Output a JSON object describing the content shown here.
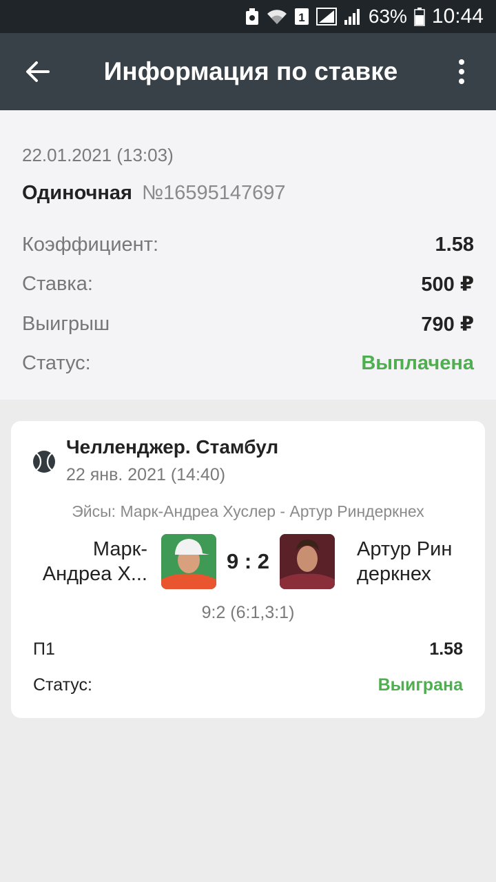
{
  "status_bar": {
    "sim_label": "1",
    "battery": "63%",
    "time": "10:44"
  },
  "app_bar": {
    "title": "Информация по ставке",
    "back_icon": "arrow-back-icon",
    "menu_icon": "more-vert-icon"
  },
  "bet": {
    "date": "22.01.2021 (13:03)",
    "type": "Одиночная",
    "number": "№16595147697",
    "rows": [
      {
        "label": "Коэффициент:",
        "value": "1.58"
      },
      {
        "label": "Ставка:",
        "value": "500 ₽"
      },
      {
        "label": "Выигрыш",
        "value": "790 ₽"
      },
      {
        "label": "Статус:",
        "value": "Выплачена"
      }
    ]
  },
  "event": {
    "sport_icon": "tennis-ball-icon",
    "league": "Челленджер. Стамбул",
    "date": "22 янв. 2021 (14:40)",
    "market": "Эйсы: Марк-Андреа Хуслер - Артур Риндеркнех",
    "team1_line1": "Марк-",
    "team1_line2": "Андреа Х...",
    "team2_line1": "Артур Рин",
    "team2_line2": "деркнех",
    "score": "9 : 2",
    "sets": "9:2 (6:1,3:1)",
    "outcome_label": "П1",
    "outcome_coef": "1.58",
    "status_label": "Статус:",
    "status_value": "Выиграна"
  },
  "colors": {
    "status_bar": "#1f2528",
    "app_bar": "#374147",
    "success_green": "#4fae4f",
    "background": "#ececec",
    "summary_bg": "#f4f4f6"
  }
}
